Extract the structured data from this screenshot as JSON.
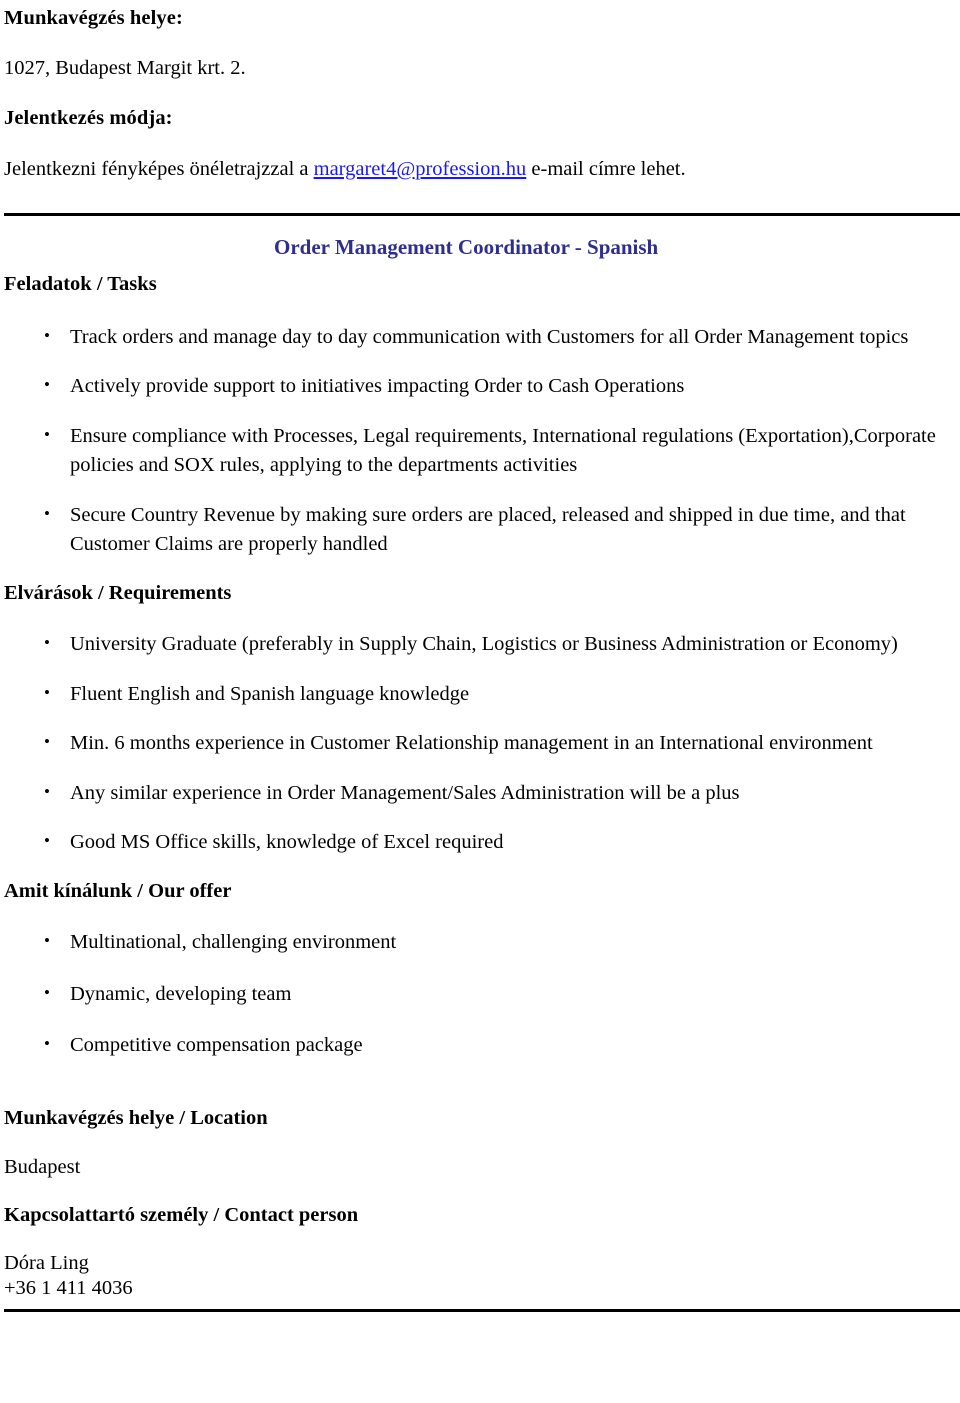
{
  "document": {
    "top_section": {
      "location_label": "Munkavégzés helye:",
      "location_value": "1027, Budapest Margit krt. 2.",
      "apply_label": "Jelentkezés módja:",
      "apply_text_before": "Jelentkezni fényképes önéletrajzzal a ",
      "apply_email": "margaret4@profession.hu",
      "apply_text_after": " e-mail címre lehet."
    },
    "job": {
      "title": "Order Management Coordinator - Spanish",
      "title_color": "#2e2e8f",
      "link_color": "#1a1aee",
      "sections": [
        {
          "heading": "Feladatok / Tasks",
          "items": [
            "Track orders and manage day to day communication with Customers for all Order Management topics",
            "Actively provide support to initiatives impacting Order to Cash Operations",
            "Ensure compliance with Processes, Legal requirements, International regulations (Exportation),Corporate policies and SOX rules, applying to the departments activities",
            "Secure Country Revenue by making sure orders are placed, released and shipped in due time, and that Customer Claims are properly handled"
          ]
        },
        {
          "heading": "Elvárások / Requirements",
          "items": [
            "University Graduate (preferably in Supply Chain, Logistics or Business Administration or Economy)",
            "Fluent English and Spanish language knowledge",
            "Min. 6 months experience in Customer Relationship management in an International environment",
            "Any similar experience in Order Management/Sales Administration will be a plus",
            "Good MS Office skills, knowledge of Excel required"
          ]
        },
        {
          "heading": "Amit kínálunk / Our offer",
          "items": [
            "Multinational, challenging environment",
            "Dynamic, developing team",
            "Competitive compensation package"
          ]
        }
      ],
      "location_heading": "Munkavégzés helye / Location",
      "location_value": "Budapest",
      "contact_heading": "Kapcsolattartó személy / Contact person",
      "contact_name": "Dóra Ling",
      "contact_phone": "+36 1 411 4036"
    }
  }
}
